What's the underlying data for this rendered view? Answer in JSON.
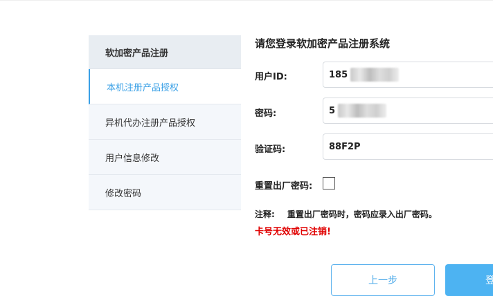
{
  "sidebar": {
    "header": "软加密产品注册",
    "items": [
      {
        "label": "本机注册产品授权",
        "active": true
      },
      {
        "label": "异机代办注册产品授权",
        "active": false
      },
      {
        "label": "用户信息修改",
        "active": false
      },
      {
        "label": "修改密码",
        "active": false
      }
    ]
  },
  "form": {
    "title": "请您登录软加密产品注册系统",
    "user_id": {
      "label": "用户ID:",
      "value": "185"
    },
    "password": {
      "label": "密码:",
      "value": "5"
    },
    "captcha": {
      "label": "验证码:",
      "value": "88F2P"
    },
    "reset": {
      "label": "重置出厂密码:"
    },
    "note_label": "注释:",
    "note_text": "重置出厂密码时，密码应录入出厂密码。",
    "error": "卡号无效或已注销!"
  },
  "buttons": {
    "prev": "上一步",
    "login": "登"
  },
  "colors": {
    "accent": "#3aa0e6",
    "error": "#e00000",
    "primary_button": "#4db3f2"
  }
}
